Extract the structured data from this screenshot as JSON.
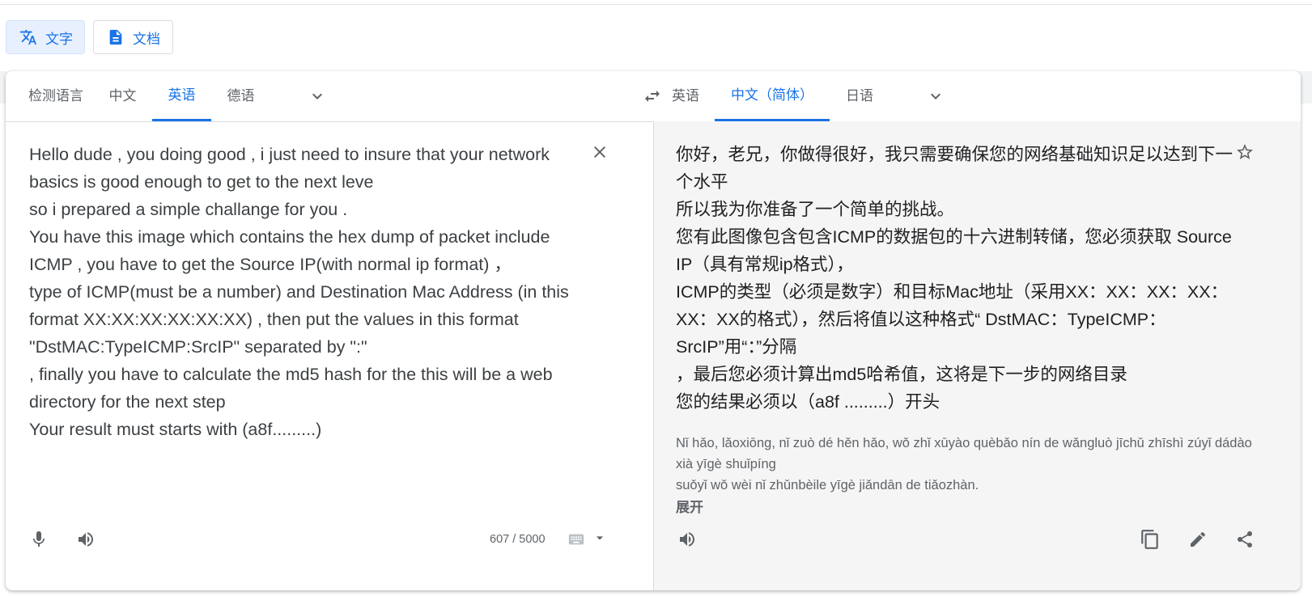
{
  "modes": [
    {
      "label": "文字",
      "icon": "translate-icon",
      "active": true
    },
    {
      "label": "文档",
      "icon": "document-icon",
      "active": false
    }
  ],
  "source_langs": [
    "检测语言",
    "中文",
    "英语",
    "德语"
  ],
  "target_langs": [
    "英语",
    "中文（简体）",
    "日语"
  ],
  "source_text": "Hello dude , you doing good , i just need to insure that your network basics is good enough to get to the next leve\nso i prepared a simple challange for you .\nYou have this image which contains the hex dump of packet include ICMP , you have to get the Source IP(with normal ip format) ，\ntype of ICMP(must be a number) and Destination Mac Address (in this format XX:XX:XX:XX:XX:XX) , then put the values in this format \"DstMAC:TypeICMP:SrcIP\" separated by \":\"\n, finally you have to calculate the md5 hash for the this will be a web directory for the next step\nYour result must starts with (a8f.........)",
  "translated_text": "你好，老兄，你做得很好，我只需要确保您的网络基础知识足以达到下一个水平\n所以我为你准备了一个简单的挑战。\n您有此图像包含包含ICMP的数据包的十六进制转储，您必须获取 Source IP（具有常规ip格式），\nICMP的类型（必须是数字）和目标Mac地址（采用XX：XX：XX：XX：XX：XX的格式），然后将值以这种格式“ DstMAC：TypeICMP：SrcIP”用“：”分隔\n，最后您必须计算出md5哈希值，这将是下一步的网络目录\n您的结果必须以（a8f .........）开头",
  "pinyin": "Nǐ hǎo, lǎoxiōng, nǐ zuò dé hěn hǎo, wǒ zhǐ xūyào quèbǎo nín de wǎngluò jīchǔ zhīshì zúyǐ dádào xià yīgè shuǐpíng\nsuǒyǐ wǒ wèi nǐ zhǔnbèile yīgè jiǎndān de tiǎozhàn.",
  "expand_label": "展开",
  "char_count": "607 / 5000",
  "colors": {
    "accent": "#1a73e8",
    "right_pane_bg": "#f5f5f5"
  }
}
